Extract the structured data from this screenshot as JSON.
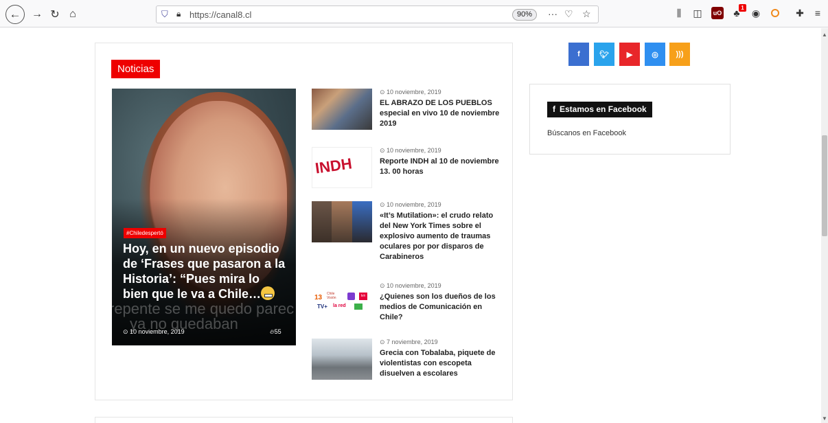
{
  "browser": {
    "url": "https://canal8.cl",
    "zoom": "90%",
    "notification_count": "1"
  },
  "section_label": "Noticias",
  "featured": {
    "category": "#Chiledespertó",
    "title": "Hoy, en un nuevo episodio de ‘Frases que pasaron a la Historia’: “Pues mira lo bien que le va a Chile…",
    "date": "10 noviembre, 2019",
    "views": "55",
    "watermark_line1": "repente se me quedo parec",
    "watermark_line2": "ya no quedaban"
  },
  "articles": [
    {
      "date": "10 noviembre, 2019",
      "title": "EL ABRAZO DE LOS PUEBLOS especial en vivo 10 de noviembre 2019"
    },
    {
      "date": "10 noviembre, 2019",
      "title": "Reporte INDH al 10 de noviembre 13. 00 horas",
      "thumb_text": "INDH"
    },
    {
      "date": "10 noviembre, 2019",
      "title": "«It’s Mutilation»: el crudo relato del New York Times sobre el explosivo aumento de traumas oculares por por disparos de Carabineros"
    },
    {
      "date": "10 noviembre, 2019",
      "title": "¿Quienes son los dueños de los medios de Comunicación en Chile?",
      "thumb_labels": [
        "13",
        "Chile Visión",
        "TV+",
        "la red",
        "tvn"
      ]
    },
    {
      "date": "7 noviembre, 2019",
      "title": "Grecia con Tobalaba, piquete de violentistas con escopeta disuelven a escolares"
    }
  ],
  "social": [
    {
      "name": "facebook",
      "glyph": "f"
    },
    {
      "name": "twitter",
      "glyph": "t"
    },
    {
      "name": "youtube",
      "glyph": "▶"
    },
    {
      "name": "instagram",
      "glyph": "◎"
    },
    {
      "name": "rss",
      "glyph": "⧟"
    }
  ],
  "facebook_widget": {
    "heading": "Estamos en Facebook",
    "link": "Búscanos en Facebook"
  },
  "colors": {
    "accent_red": "#ee0000",
    "facebook_blue": "#3b6fd0",
    "twitter_blue": "#2aa3ec",
    "youtube_red": "#e8262a",
    "instagram_blue": "#2f8ff0",
    "rss_orange": "#f7a01a"
  }
}
